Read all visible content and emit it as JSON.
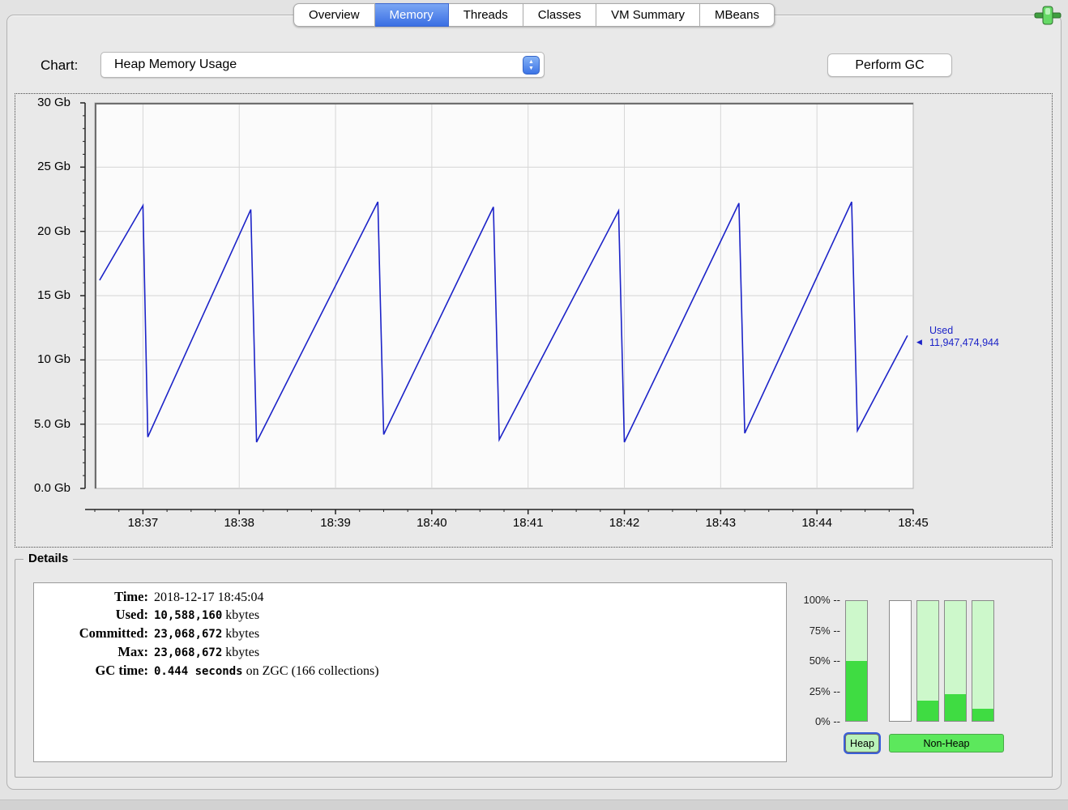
{
  "tabs": {
    "items": [
      {
        "label": "Overview",
        "selected": false
      },
      {
        "label": "Memory",
        "selected": true
      },
      {
        "label": "Threads",
        "selected": false
      },
      {
        "label": "Classes",
        "selected": false
      },
      {
        "label": "VM Summary",
        "selected": false
      },
      {
        "label": "MBeans",
        "selected": false
      }
    ]
  },
  "toolbar": {
    "chart_label": "Chart:",
    "chart_selected_option": "Heap Memory Usage",
    "perform_gc_label": "Perform GC"
  },
  "chart_data": {
    "type": "line",
    "title": "Heap Memory Usage",
    "x_ticks": [
      "18:37",
      "18:38",
      "18:39",
      "18:40",
      "18:41",
      "18:42",
      "18:43",
      "18:44",
      "18:45"
    ],
    "y_ticks": [
      {
        "gb": 30,
        "label": "30 Gb"
      },
      {
        "gb": 25,
        "label": "25 Gb"
      },
      {
        "gb": 20,
        "label": "20 Gb"
      },
      {
        "gb": 15,
        "label": "15 Gb"
      },
      {
        "gb": 10,
        "label": "10 Gb"
      },
      {
        "gb": 5,
        "label": "5.0 Gb"
      },
      {
        "gb": 0,
        "label": "0.0 Gb"
      }
    ],
    "ylim_gb": [
      0,
      30
    ],
    "x_domain_minutes": [
      -0.5,
      8
    ],
    "grid": true,
    "line_color": "#1c23c8",
    "series": [
      {
        "name": "Used",
        "points": [
          [
            -0.45,
            16.2
          ],
          [
            0.0,
            22.0
          ],
          [
            0.05,
            4.0
          ],
          [
            1.12,
            21.7
          ],
          [
            1.18,
            3.6
          ],
          [
            2.44,
            22.3
          ],
          [
            2.5,
            4.2
          ],
          [
            3.64,
            21.9
          ],
          [
            3.7,
            3.8
          ],
          [
            4.94,
            21.6
          ],
          [
            5.0,
            3.6
          ],
          [
            6.19,
            22.2
          ],
          [
            6.25,
            4.3
          ],
          [
            7.36,
            22.3
          ],
          [
            7.42,
            4.5
          ],
          [
            7.94,
            11.9
          ]
        ]
      }
    ],
    "annotation": {
      "label": "Used",
      "value": "11,947,474,944"
    }
  },
  "details": {
    "legend": "Details",
    "rows": [
      {
        "label": "Time:",
        "value": "2018-12-17 18:45:04",
        "mono": false,
        "suffix": ""
      },
      {
        "label": "Used:",
        "value": "10,588,160",
        "mono": true,
        "suffix": " kbytes"
      },
      {
        "label": "Committed:",
        "value": "23,068,672",
        "mono": true,
        "suffix": " kbytes"
      },
      {
        "label": "Max:",
        "value": "23,068,672",
        "mono": true,
        "suffix": " kbytes"
      },
      {
        "label": "GC time:",
        "value": "0.444 seconds",
        "mono": true,
        "suffix": " on ZGC (166 collections)"
      }
    ]
  },
  "gauges": {
    "tick_labels": [
      "100% --",
      "75% --",
      "50% --",
      "25% --",
      "0% --"
    ],
    "bars": [
      {
        "fill_pct": 50,
        "empty": false
      },
      {
        "fill_pct": 0,
        "empty": true
      },
      {
        "fill_pct": 17,
        "empty": false
      },
      {
        "fill_pct": 22,
        "empty": false
      },
      {
        "fill_pct": 10,
        "empty": false
      }
    ],
    "heap_button_label": "Heap",
    "nonheap_button_label": "Non-Heap"
  },
  "colors": {
    "accent_blue": "#3a6fe3",
    "chart_line": "#1c23c8",
    "gauge_fill": "#3fdc42",
    "gauge_bg": "#cdf8cb"
  }
}
